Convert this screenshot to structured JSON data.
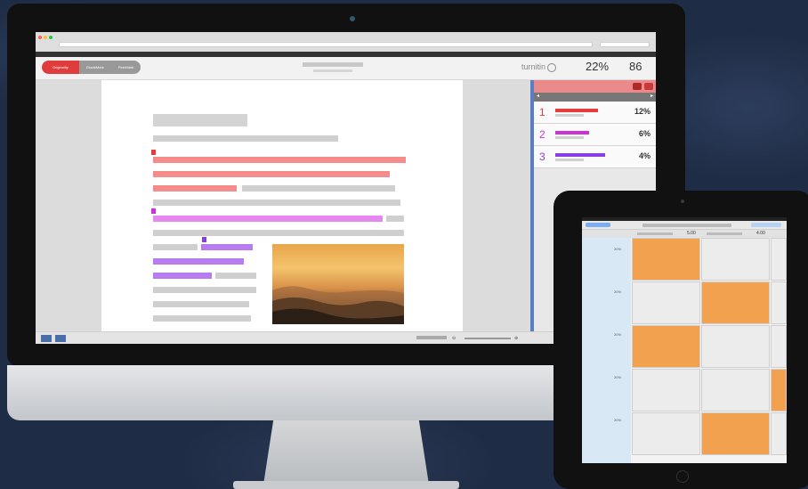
{
  "browser": {
    "traffic_lights": [
      "#ff5f57",
      "#febc2e",
      "#28c840"
    ]
  },
  "toolbar": {
    "tabs": [
      {
        "label": "Originality",
        "active": true
      },
      {
        "label": "GradeMark",
        "active": false
      },
      {
        "label": "PeerMark",
        "active": false
      }
    ],
    "brand": "turnitin",
    "similarity": "22%",
    "score": "86"
  },
  "matches": [
    {
      "num": "1",
      "pct": "12%",
      "color": "#e53c3c"
    },
    {
      "num": "2",
      "pct": "6%",
      "color": "#cc33d6"
    },
    {
      "num": "3",
      "pct": "4%",
      "color": "#8a3ee6"
    }
  ],
  "ipad": {
    "header_values": [
      "5.00",
      "4.00"
    ],
    "row_labels": [
      "20%",
      "20%",
      "20%",
      "20%",
      "20%"
    ]
  },
  "colors": {
    "accent": "#e03c3c",
    "highlight_blue": "#5b7ec2",
    "orange": "#f2a24e"
  }
}
